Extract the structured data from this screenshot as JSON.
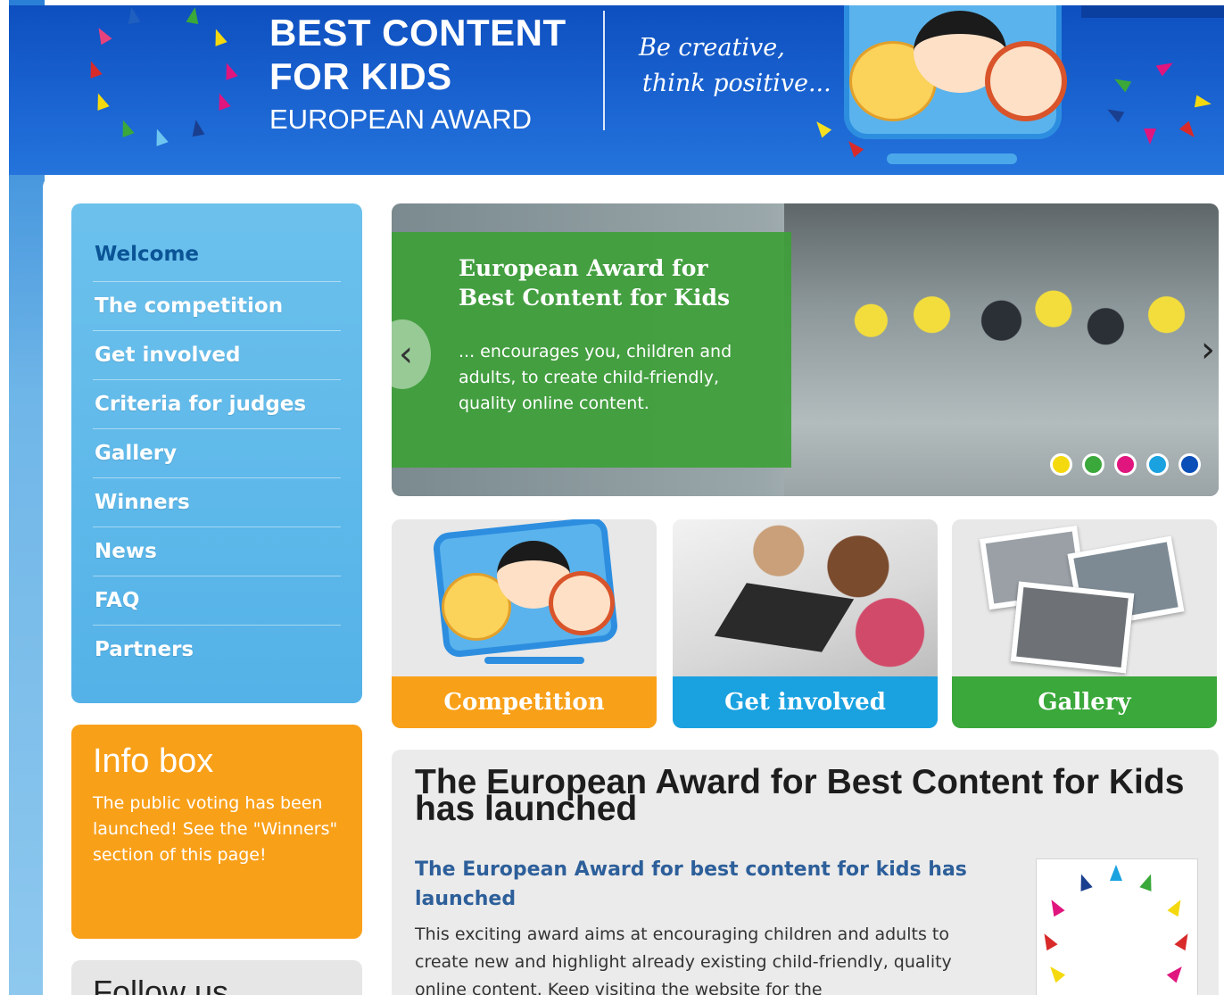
{
  "header": {
    "title_line1": "BEST CONTENT",
    "title_line2": "FOR KIDS",
    "subtitle": "EUROPEAN AWARD",
    "slogan_line1": "Be creative,",
    "slogan_line2": "think positive..."
  },
  "nav": {
    "items": [
      {
        "label": "Welcome",
        "active": true
      },
      {
        "label": "The competition"
      },
      {
        "label": "Get involved"
      },
      {
        "label": "Criteria for judges"
      },
      {
        "label": "Gallery"
      },
      {
        "label": "Winners"
      },
      {
        "label": "News"
      },
      {
        "label": "FAQ"
      },
      {
        "label": "Partners"
      }
    ]
  },
  "info_box": {
    "title": "Info box",
    "text": "The public voting has been launched! See the \"Winners\" section of this page!"
  },
  "follow": {
    "title": "Follow us"
  },
  "slider": {
    "title": "European Award for Best Content for Kids",
    "text": "... encourages you, children and adults, to create child-friendly, quality online content.",
    "prev_icon": "chevron-left-icon",
    "next_icon": "chevron-right-icon",
    "dot_colors": [
      "#f5d90f",
      "#3aa83a",
      "#e0157e",
      "#1aa1e0",
      "#0a4fb8"
    ]
  },
  "tiles": [
    {
      "label": "Competition",
      "color": "#f9a019"
    },
    {
      "label": "Get involved",
      "color": "#1aa1e0"
    },
    {
      "label": "Gallery",
      "color": "#3aa83a"
    }
  ],
  "article": {
    "title": "The European Award for Best Content for Kids has launched",
    "subtitle": "The European Award for best content for kids has launched",
    "body": "This exciting award aims at encouraging children and adults to create new and highlight already existing child-friendly, quality online content. Keep visiting the website for the"
  },
  "colors": {
    "header_blue": "#1a63d1",
    "nav_blue": "#5cb6ea",
    "orange": "#f9a019",
    "green": "#3aa83a",
    "link_blue": "#2d5f9a"
  }
}
